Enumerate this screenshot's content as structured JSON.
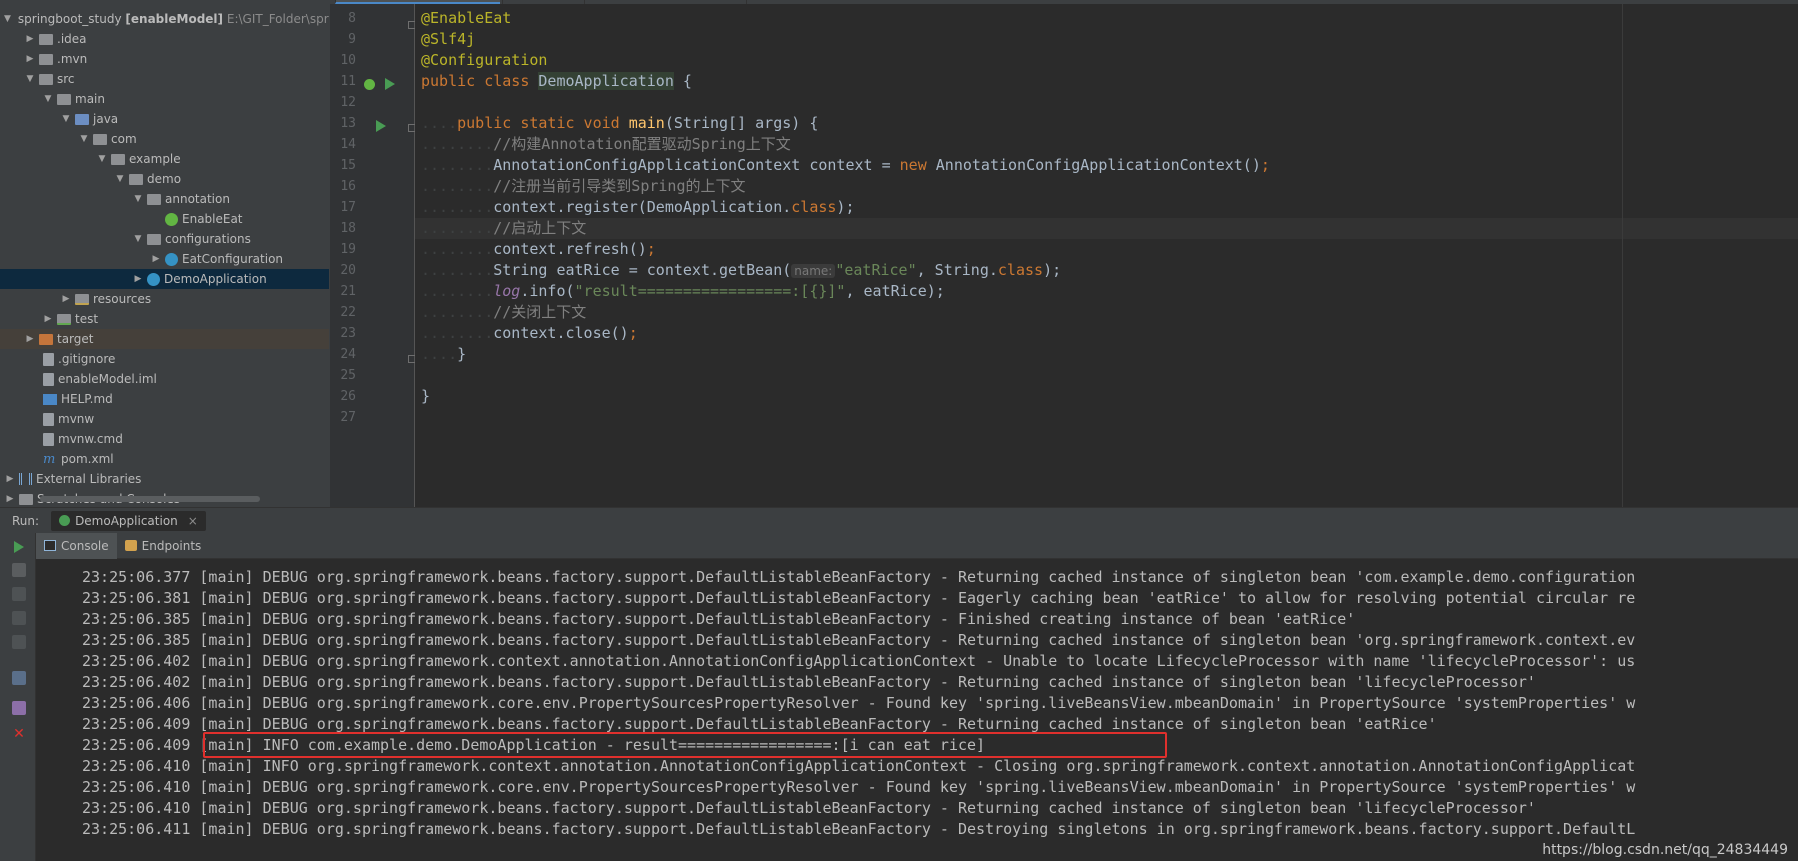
{
  "colors": {
    "accent": "#4a88c7",
    "highlight_box": "#e0302d",
    "run_green": "#499c54"
  },
  "project": {
    "rows": [
      {
        "label": "springboot_study",
        "module": "[enableModel]",
        "path": "E:\\GIT_Folder\\spring",
        "icon": "folder-icon"
      },
      {
        "label": ".idea",
        "icon": "folder-icon"
      },
      {
        "label": ".mvn",
        "icon": "folder-icon"
      },
      {
        "label": "src",
        "icon": "folder-icon"
      },
      {
        "label": "main",
        "icon": "folder-icon"
      },
      {
        "label": "java",
        "icon": "source-folder-icon"
      },
      {
        "label": "com",
        "icon": "package-icon"
      },
      {
        "label": "example",
        "icon": "package-icon"
      },
      {
        "label": "demo",
        "icon": "package-icon"
      },
      {
        "label": "annotation",
        "icon": "package-icon"
      },
      {
        "label": "EnableEat",
        "icon": "annotation-icon"
      },
      {
        "label": "configurations",
        "icon": "package-icon"
      },
      {
        "label": "EatConfiguration",
        "icon": "class-icon"
      },
      {
        "label": "DemoApplication",
        "icon": "class-icon"
      },
      {
        "label": "resources",
        "icon": "resources-folder-icon"
      },
      {
        "label": "test",
        "icon": "test-folder-icon"
      },
      {
        "label": "target",
        "icon": "excluded-folder-icon"
      },
      {
        "label": ".gitignore",
        "icon": "file-icon"
      },
      {
        "label": "enableModel.iml",
        "icon": "file-icon"
      },
      {
        "label": "HELP.md",
        "icon": "markdown-icon"
      },
      {
        "label": "mvnw",
        "icon": "file-icon"
      },
      {
        "label": "mvnw.cmd",
        "icon": "file-icon"
      },
      {
        "label": "pom.xml",
        "icon": "maven-icon"
      },
      {
        "label": "External Libraries",
        "icon": "library-icon"
      },
      {
        "label": "Scratches and Consoles",
        "icon": "scratch-icon"
      }
    ]
  },
  "editor": {
    "line_numbers": [
      "8",
      "9",
      "10",
      "11",
      "12",
      "13",
      "14",
      "15",
      "16",
      "17",
      "18",
      "19",
      "20",
      "21",
      "22",
      "23",
      "24",
      "25",
      "26",
      "27"
    ],
    "l8": "@EnableEat",
    "l9": "@Slf4j",
    "l10": "@Configuration",
    "l11_kw": "public class ",
    "l11_cls": "DemoApplication",
    "l11_rest": " {",
    "l13_kw": "public static void ",
    "l13_mt": "main",
    "l13_rest": "(String[] args) {",
    "l14": "//构建Annotation配置驱动Spring上下文",
    "l15_a": "AnnotationConfigApplicationContext context = ",
    "l15_kw": "new",
    "l15_b": " AnnotationConfigApplicationContext()",
    "l16": "//注册当前引导类到Spring的上下文",
    "l17_a": "context.register(DemoApplication.",
    "l17_kw": "class",
    "l17_b": ");",
    "l18": "//启动上下文",
    "l19_a": "context.refresh()",
    "l20_a": "String eatRice = context.getBean(",
    "l20_hint": "name:",
    "l20_str": "\"eatRice\"",
    "l20_b": ", String.",
    "l20_kw": "class",
    "l20_c": ");",
    "l21_it": "log",
    "l21_a": ".info(",
    "l21_str": "\"result=================:[{}]\"",
    "l21_b": ", eatRice);",
    "l22": "//关闭上下文",
    "l23_a": "context.close()",
    "l24": "}",
    "l26": "}",
    "semicolon": ";",
    "dots4": "....",
    "dots8": "........"
  },
  "run": {
    "label": "Run:",
    "tab": "DemoApplication",
    "close": "×",
    "console_tab": "Console",
    "endpoints_tab": "Endpoints"
  },
  "console": {
    "lines": [
      "23:25:06.377 [main] DEBUG org.springframework.beans.factory.support.DefaultListableBeanFactory - Returning cached instance of singleton bean 'com.example.demo.configuration",
      "23:25:06.381 [main] DEBUG org.springframework.beans.factory.support.DefaultListableBeanFactory - Eagerly caching bean 'eatRice' to allow for resolving potential circular re",
      "23:25:06.385 [main] DEBUG org.springframework.beans.factory.support.DefaultListableBeanFactory - Finished creating instance of bean 'eatRice'",
      "23:25:06.385 [main] DEBUG org.springframework.beans.factory.support.DefaultListableBeanFactory - Returning cached instance of singleton bean 'org.springframework.context.ev",
      "23:25:06.402 [main] DEBUG org.springframework.context.annotation.AnnotationConfigApplicationContext - Unable to locate LifecycleProcessor with name 'lifecycleProcessor': us",
      "23:25:06.402 [main] DEBUG org.springframework.beans.factory.support.DefaultListableBeanFactory - Returning cached instance of singleton bean 'lifecycleProcessor'",
      "23:25:06.406 [main] DEBUG org.springframework.core.env.PropertySourcesPropertyResolver - Found key 'spring.liveBeansView.mbeanDomain' in PropertySource 'systemProperties' w",
      "23:25:06.409 [main] DEBUG org.springframework.beans.factory.support.DefaultListableBeanFactory - Returning cached instance of singleton bean 'eatRice'",
      "23:25:06.409 [main] INFO com.example.demo.DemoApplication - result=================:[i can eat rice]",
      "23:25:06.410 [main] INFO org.springframework.context.annotation.AnnotationConfigApplicationContext - Closing org.springframework.context.annotation.AnnotationConfigApplicat",
      "23:25:06.410 [main] DEBUG org.springframework.core.env.PropertySourcesPropertyResolver - Found key 'spring.liveBeansView.mbeanDomain' in PropertySource 'systemProperties' w",
      "23:25:06.410 [main] DEBUG org.springframework.beans.factory.support.DefaultListableBeanFactory - Returning cached instance of singleton bean 'lifecycleProcessor'",
      "23:25:06.411 [main] DEBUG org.springframework.beans.factory.support.DefaultListableBeanFactory - Destroying singletons in org.springframework.beans.factory.support.DefaultL"
    ]
  },
  "watermark": "https://blog.csdn.net/qq_24834449"
}
